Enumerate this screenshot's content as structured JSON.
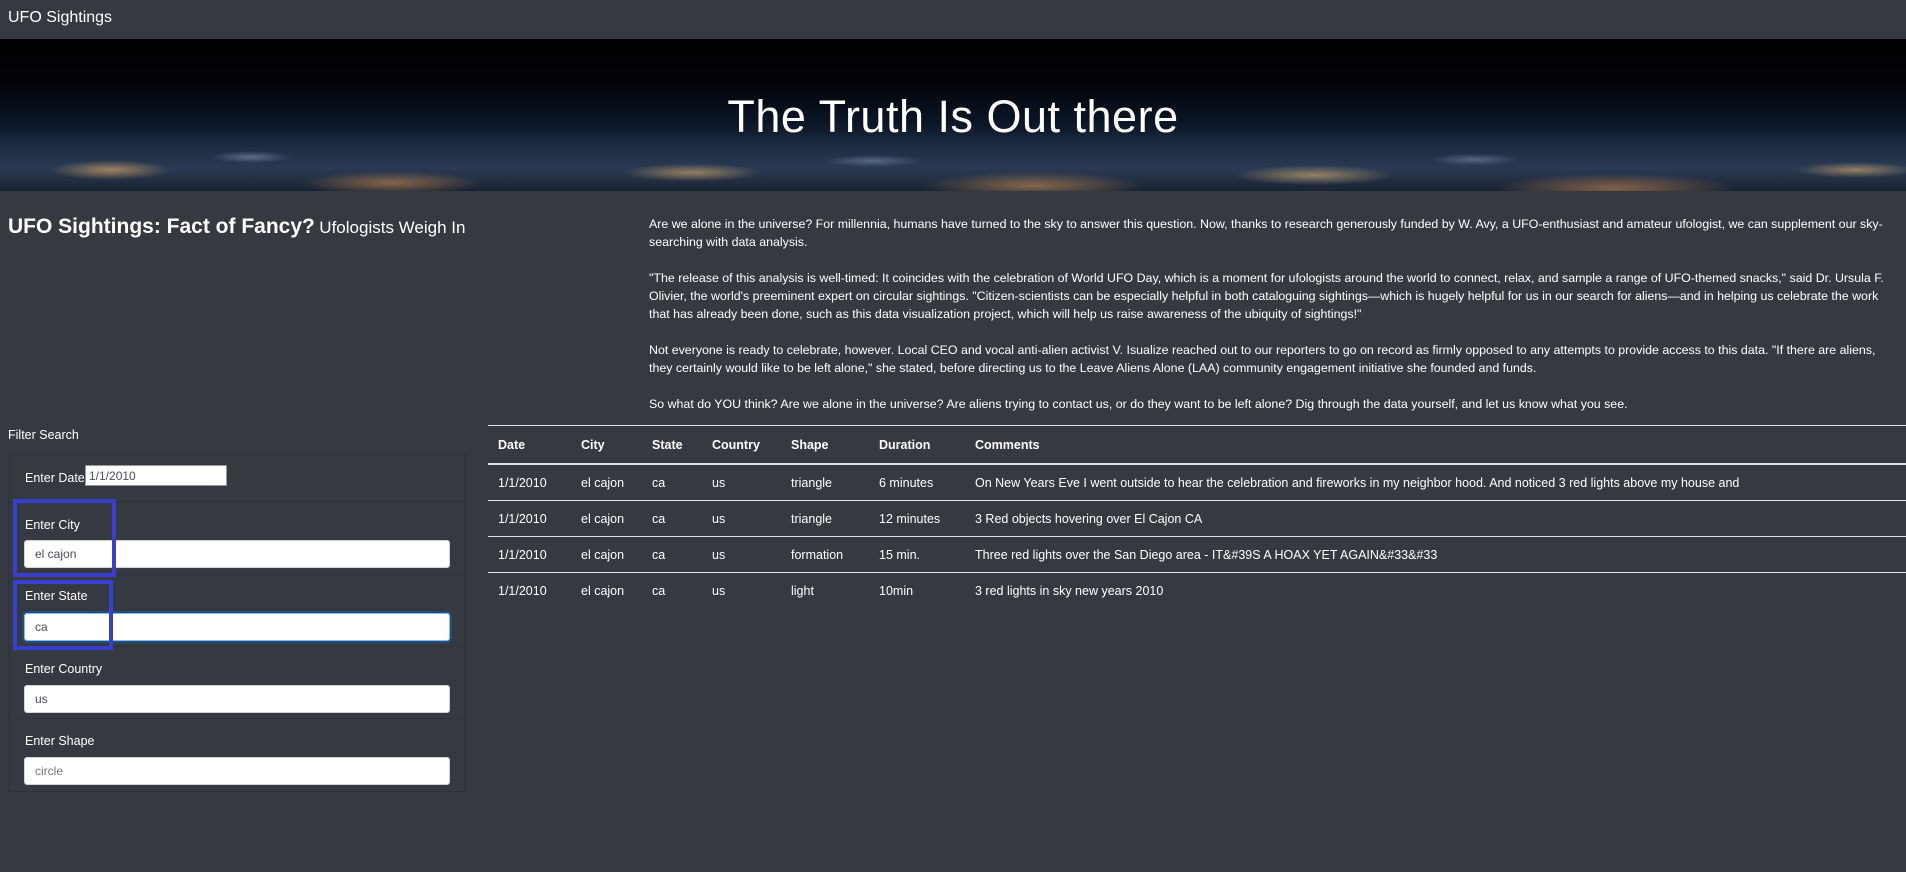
{
  "navbar": {
    "brand": "UFO Sightings"
  },
  "hero": {
    "title": "The Truth Is Out there"
  },
  "article": {
    "heading": "UFO Sightings: Fact of Fancy?",
    "subheading": "Ufologists Weigh In",
    "paragraphs": [
      "Are we alone in the universe? For millennia, humans have turned to the sky to answer this question. Now, thanks to research generously funded by W. Avy, a UFO-enthusiast and amateur ufologist, we can supplement our sky-searching with data analysis.",
      "\"The release of this analysis is well-timed: It coincides with the celebration of World UFO Day, which is a moment for ufologists around the world to connect, relax, and sample a range of UFO-themed snacks,\" said Dr. Ursula F. Olivier, the world's preeminent expert on circular sightings. \"Citizen-scientists can be especially helpful in both cataloguing sightings—which is hugely helpful for us in our search for aliens—and in helping us celebrate the work that has already been done, such as this data visualization project, which will help us raise awareness of the ubiquity of sightings!\"",
      "Not everyone is ready to celebrate, however. Local CEO and vocal anti-alien activist V. Isualize reached out to our reporters to go on record as firmly opposed to any attempts to provide access to this data. \"If there are aliens, they certainly would like to be left alone,\" she stated, before directing us to the Leave Aliens Alone (LAA) community engagement initiative she founded and funds.",
      "So what do YOU think? Are we alone in the universe? Are aliens trying to contact us, or do they want to be left alone? Dig through the data yourself, and let us know what you see."
    ]
  },
  "filters": {
    "title": "Filter Search",
    "date": {
      "label": "Enter Date",
      "value": "1/1/2010"
    },
    "city": {
      "label": "Enter City",
      "value": "el cajon"
    },
    "state": {
      "label": "Enter State",
      "value": "ca"
    },
    "country": {
      "label": "Enter Country",
      "value": "us"
    },
    "shape": {
      "label": "Enter Shape",
      "placeholder": "circle"
    }
  },
  "table": {
    "headers": [
      "Date",
      "City",
      "State",
      "Country",
      "Shape",
      "Duration",
      "Comments"
    ],
    "rows": [
      [
        "1/1/2010",
        "el cajon",
        "ca",
        "us",
        "triangle",
        "6 minutes",
        "On New Years Eve I went outside to hear the celebration and fireworks in my neighbor hood. And noticed 3 red lights above my house and"
      ],
      [
        "1/1/2010",
        "el cajon",
        "ca",
        "us",
        "triangle",
        "12 minutes",
        "3 Red objects hovering over El Cajon CA"
      ],
      [
        "1/1/2010",
        "el cajon",
        "ca",
        "us",
        "formation",
        "15 min.",
        "Three red lights over the San Diego area - IT&#39S A HOAX YET AGAIN&#33&#33"
      ],
      [
        "1/1/2010",
        "el cajon",
        "ca",
        "us",
        "light",
        "10min",
        "3 red lights in sky new years 2010"
      ]
    ]
  },
  "colors": {
    "background": "#343a40",
    "highlight_box": "#3a3ed0",
    "focus_ring": "#80bdff"
  }
}
